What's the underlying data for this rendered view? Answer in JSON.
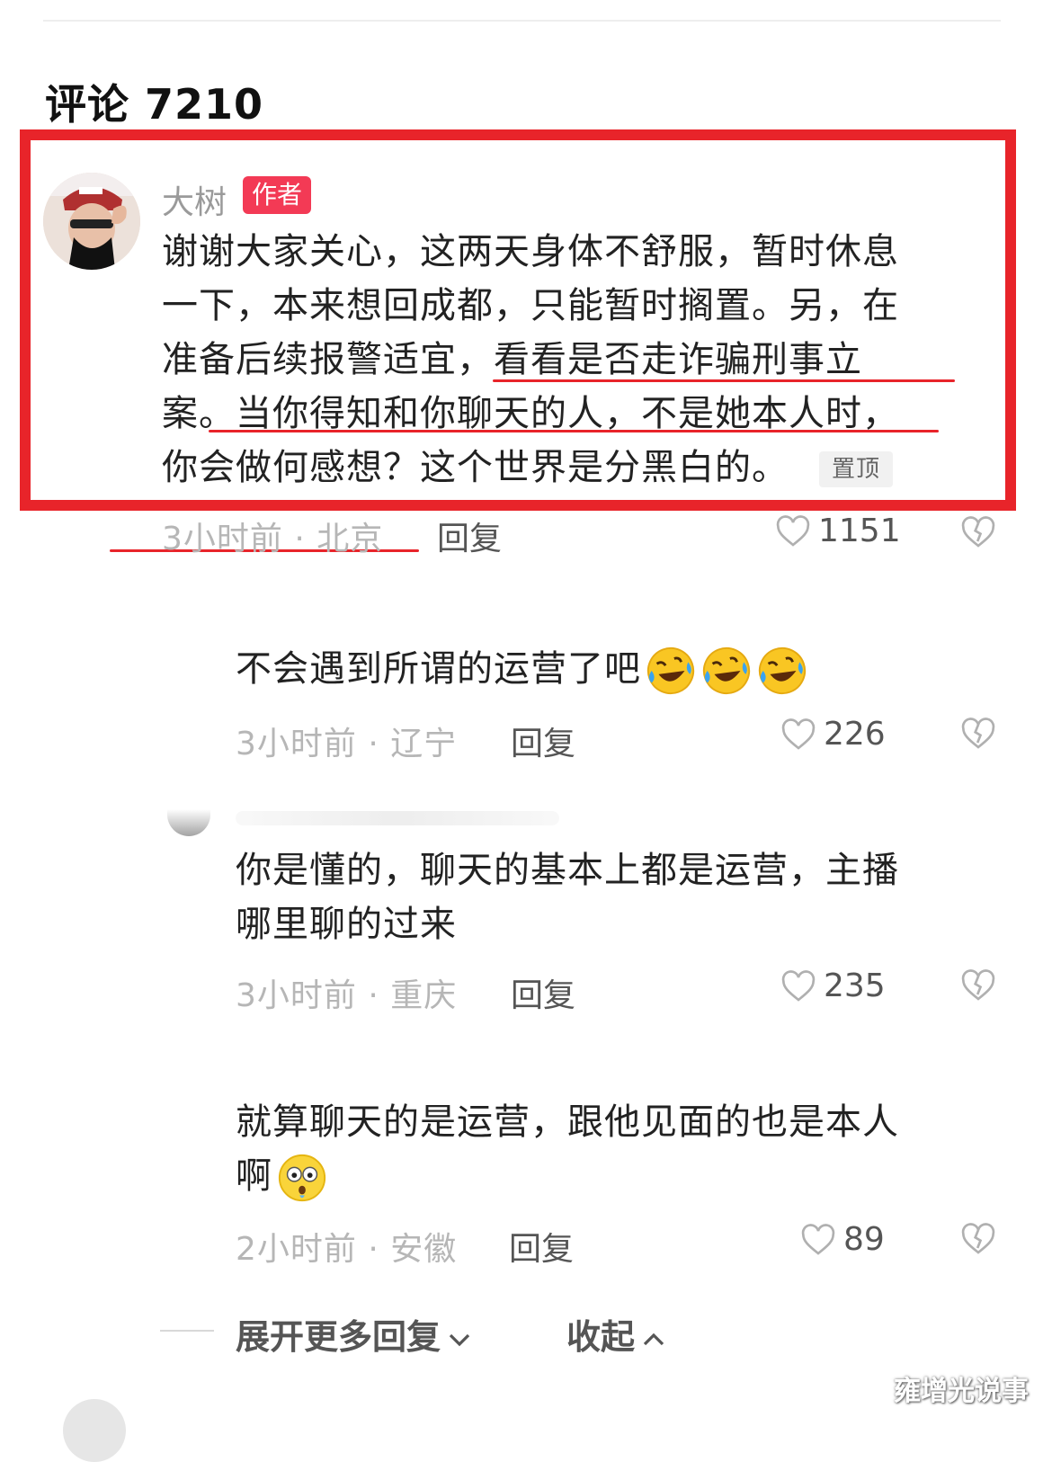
{
  "header": {
    "title": "评论 7210"
  },
  "main_comment": {
    "username": "大树",
    "author_tag": "作者",
    "lines": [
      "谢谢大家关心，这两天身体不舒服，暂时休息",
      "一下，本来想回成都，只能暂时搁置。另，在",
      "准备后续报警适宜，看看是否走诈骗刑事立",
      "案。当你得知和你聊天的人，不是她本人时，",
      "你会做何感想？这个世界是分黑白的。"
    ],
    "pinned_label": "置顶",
    "meta": "3小时前 · 北京",
    "reply_label": "回复",
    "likes": "1151"
  },
  "replies": [
    {
      "text_lines": [
        "不会遇到所谓的运营了吧"
      ],
      "emoji": "laughing-crying-emoji",
      "emoji_count": 3,
      "meta": "3小时前 · 辽宁",
      "reply_label": "回复",
      "likes": "226"
    },
    {
      "text_lines": [
        "你是懂的，聊天的基本上都是运营，主播",
        "哪里聊的过来"
      ],
      "meta": "3小时前 · 重庆",
      "reply_label": "回复",
      "likes": "235"
    },
    {
      "text_lines": [
        "就算聊天的是运营，跟他见面的也是本人",
        "啊"
      ],
      "emoji": "shocked-face-emoji",
      "meta": "2小时前 · 安徽",
      "reply_label": "回复",
      "likes": "89"
    }
  ],
  "footer": {
    "expand_label": "展开更多回复",
    "collapse_label": "收起"
  },
  "watermark": "雍增光说事",
  "colors": {
    "highlight": "#e8242a",
    "author_tag": "#f33a55"
  },
  "icons": [
    "heart-outline-icon",
    "broken-heart-icon",
    "chevron-down-icon",
    "chevron-up-icon"
  ]
}
